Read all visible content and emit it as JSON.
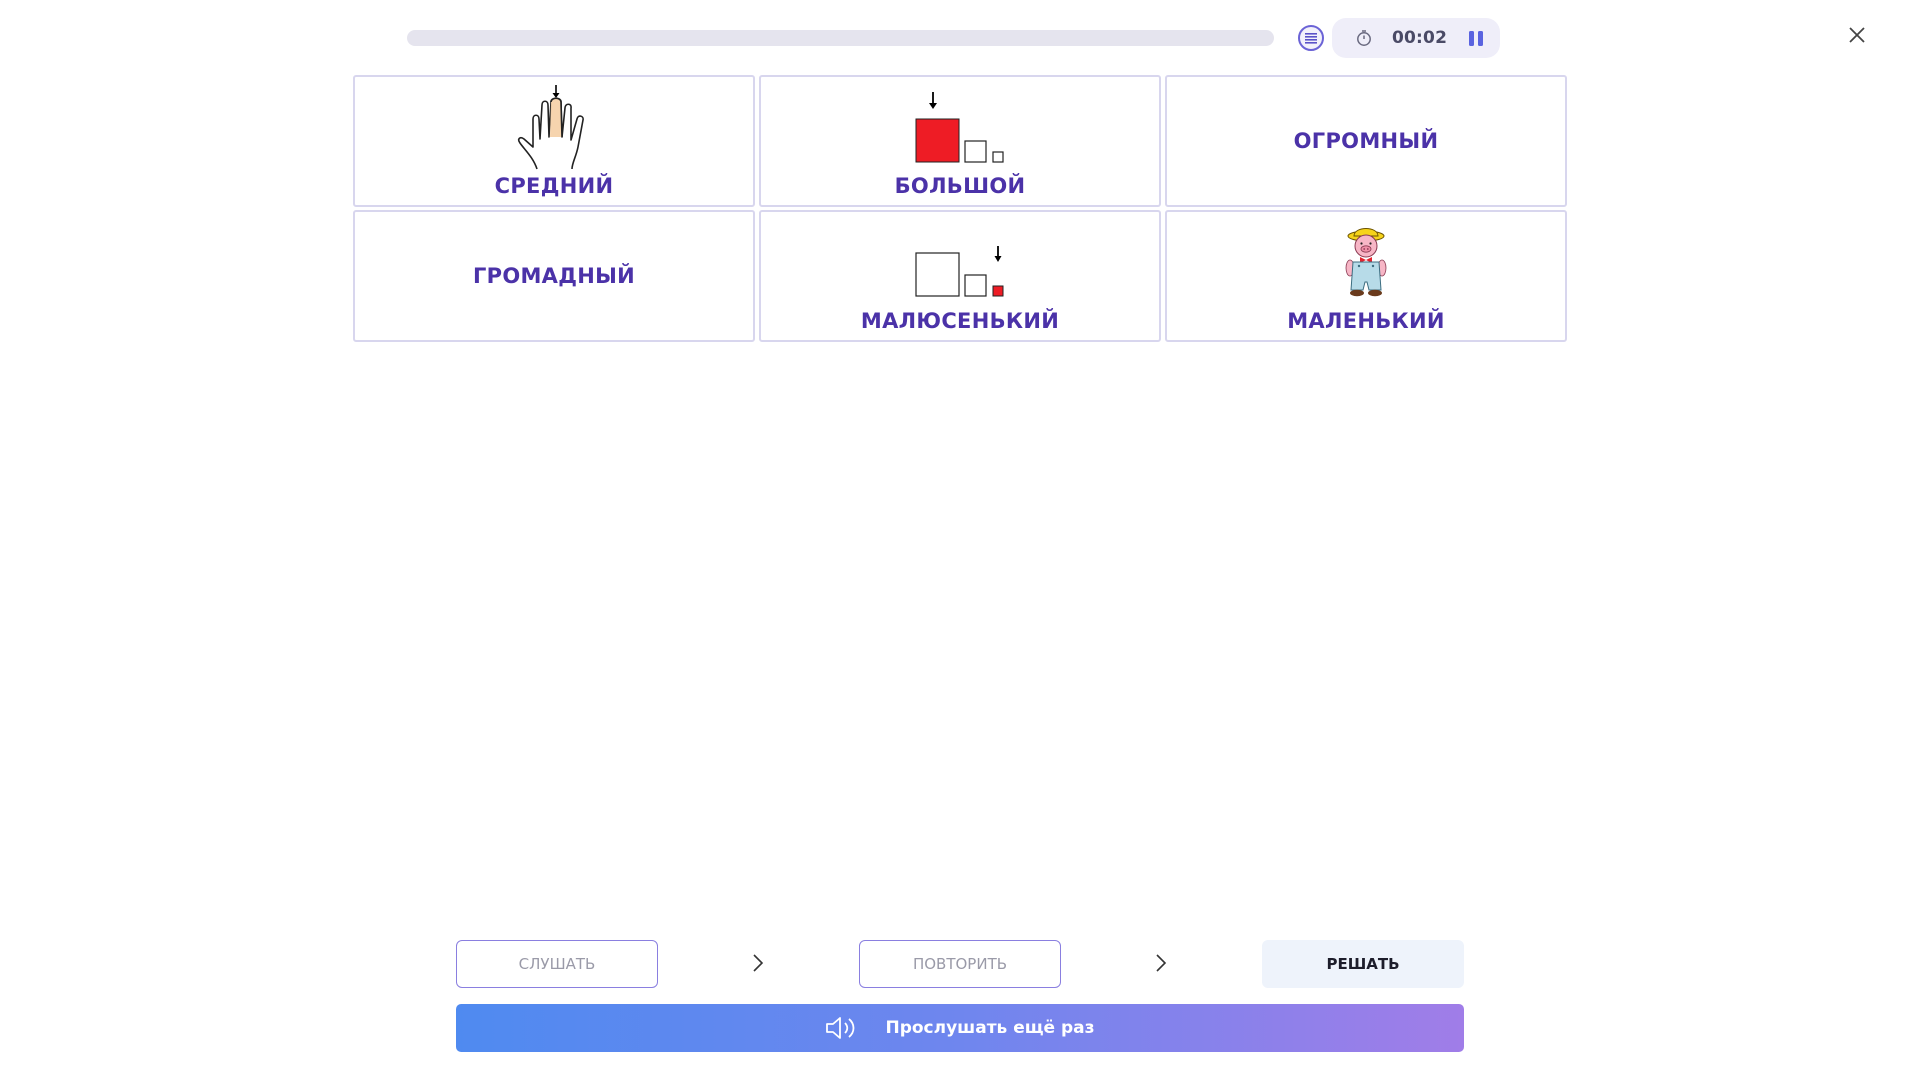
{
  "header": {
    "progress_percent": 0,
    "timer": "00:02",
    "icons": {
      "list": "list-icon",
      "timer": "stopwatch-icon",
      "pause": "pause-icon",
      "close": "close-icon"
    }
  },
  "cards": [
    {
      "label": "СРЕДНИЙ",
      "picture": "hand-middle-finger-icon"
    },
    {
      "label": "БОЛЬШОЙ",
      "picture": "big-square-icon"
    },
    {
      "label": "ОГРОМНЫЙ",
      "picture": ""
    },
    {
      "label": "ГРОМАДНЫЙ",
      "picture": ""
    },
    {
      "label": "МАЛЮСЕНЬКИЙ",
      "picture": "tiny-square-icon"
    },
    {
      "label": "МАЛЕНЬКИЙ",
      "picture": "piglet-icon"
    }
  ],
  "steps": {
    "listen": "СЛУШАТЬ",
    "repeat": "ПОВТОРИТЬ",
    "solve": "РЕШАТЬ"
  },
  "listen_again": {
    "label": "Прослушать ещё раз",
    "icon": "speaker-icon"
  },
  "colors": {
    "accent": "#4b32a8",
    "card_border": "#d8d6ee",
    "picture_red": "#ee1c25",
    "gradient_start": "#4f8af0",
    "gradient_end": "#a07de8"
  }
}
